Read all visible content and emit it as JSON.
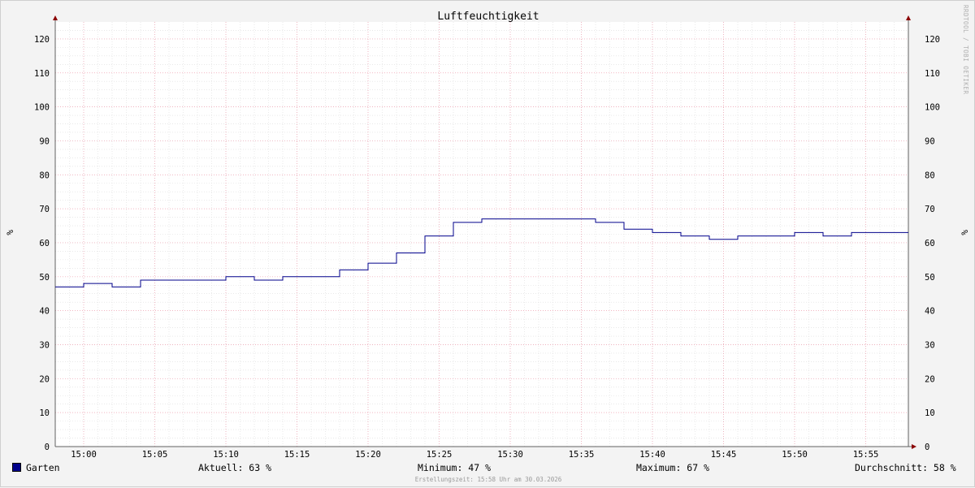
{
  "chart_data": {
    "type": "line",
    "title": "Luftfeuchtigkeit",
    "ylabel": "%",
    "ylim": [
      0,
      125
    ],
    "xlim": [
      "14:58",
      "15:58"
    ],
    "y_ticks": [
      0,
      10,
      20,
      30,
      40,
      50,
      60,
      70,
      80,
      90,
      100,
      110,
      120
    ],
    "x_tick_labels": [
      "15:00",
      "15:05",
      "15:10",
      "15:15",
      "15:20",
      "15:25",
      "15:30",
      "15:35",
      "15:40",
      "15:45",
      "15:50",
      "15:55"
    ],
    "step": "post",
    "grid": true,
    "series": [
      {
        "name": "Garten",
        "color": "#00008b",
        "x": [
          "14:58",
          "15:00",
          "15:02",
          "15:04",
          "15:06",
          "15:08",
          "15:10",
          "15:12",
          "15:14",
          "15:16",
          "15:18",
          "15:20",
          "15:22",
          "15:24",
          "15:26",
          "15:28",
          "15:30",
          "15:32",
          "15:34",
          "15:36",
          "15:38",
          "15:40",
          "15:42",
          "15:44",
          "15:46",
          "15:48",
          "15:50",
          "15:52",
          "15:54",
          "15:56",
          "15:58"
        ],
        "y": [
          47,
          48,
          47,
          49,
          49,
          49,
          50,
          49,
          50,
          50,
          52,
          54,
          57,
          62,
          66,
          67,
          67,
          67,
          67,
          66,
          64,
          63,
          62,
          61,
          62,
          62,
          63,
          62,
          63,
          63,
          63
        ]
      }
    ]
  },
  "legend": {
    "series_name": "Garten",
    "series_color": "#00008b",
    "aktuell": "Aktuell:  63 %",
    "minimum": "Minimum:  47 %",
    "maximum": "Maximum:  67 %",
    "durchschnitt": "Durchschnitt:  58 %"
  },
  "footer": "Erstellungszeit: 15:58 Uhr am 30.03.2026",
  "watermark": "RRDTOOL / TOBI OETIKER"
}
